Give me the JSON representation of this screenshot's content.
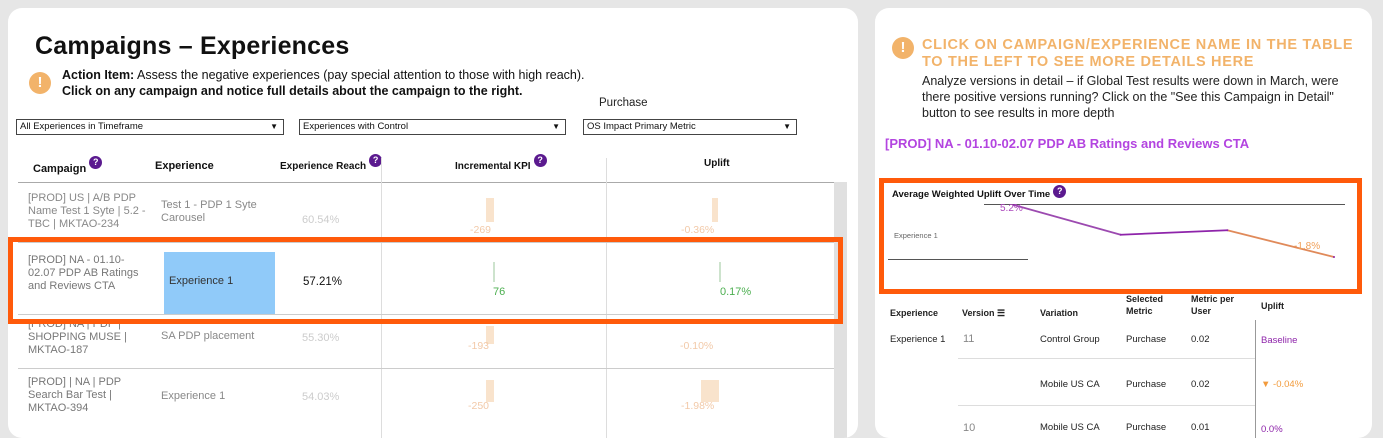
{
  "left": {
    "title": "Campaigns – Experiences",
    "action_label": "Action Item:",
    "action_text": " Assess the negative experiences (pay special attention to those with high reach).",
    "action_bold": "Click on any campaign and notice full details about the campaign to the right.",
    "purchase_label": "Purchase",
    "filters": [
      {
        "value": "All Experiences in Timeframe"
      },
      {
        "value": "Experiences with Control"
      },
      {
        "value": "OS Impact Primary Metric"
      }
    ],
    "headers": {
      "campaign": "Campaign",
      "experience": "Experience",
      "reach": "Experience Reach",
      "kpi": "Incremental KPI",
      "uplift": "Uplift"
    },
    "rows": [
      {
        "campaign": "[PROD] US | A/B PDP Name Test 1 Syte | 5.2 - TBC | MKTAO-234",
        "experience": "Test 1 - PDP 1 Syte Carousel",
        "reach": "60.54%",
        "kpi": "-269",
        "uplift": "-0.36%"
      },
      {
        "campaign": "[PROD] NA - 01.10-02.07 PDP AB Ratings and Reviews CTA",
        "experience": "Experience 1",
        "reach": "57.21%",
        "kpi": "76",
        "uplift": "0.17%"
      },
      {
        "campaign": "[PROD] NA | PDP | SHOPPING MUSE | MKTAO-187",
        "experience": "SA PDP placement",
        "reach": "55.30%",
        "kpi": "-193",
        "uplift": "-0.10%"
      },
      {
        "campaign": "[PROD] | NA | PDP Search Bar Test | MKTAO-394",
        "experience": "Experience 1",
        "reach": "54.03%",
        "kpi": "-250",
        "uplift": "-1.98%"
      }
    ]
  },
  "right": {
    "click_text": "CLICK ON CAMPAIGN/EXPERIENCE NAME IN THE TABLE TO THE LEFT TO SEE MORE DETAILS HERE",
    "analyze_text": "Analyze versions in detail – if Global Test results were down in March, were there positive versions running? Click on the \"See this Campaign in Detail\" button to see results in more depth",
    "campaign_name": "[PROD] NA - 01.10-02.07 PDP AB Ratings and Reviews CTA",
    "chart_title": "Average Weighted Uplift Over Time",
    "table_headers": {
      "experience": "Experience",
      "version": "Version",
      "variation": "Variation",
      "metric": "Selected Metric",
      "metric_per_user": "Metric per User",
      "uplift": "Uplift"
    },
    "table_rows": [
      {
        "experience": "Experience 1",
        "version": "11",
        "variation": "Control Group",
        "metric": "Purchase",
        "per_user": "0.02",
        "uplift": "Baseline"
      },
      {
        "experience": "",
        "version": "",
        "variation": "Mobile US CA",
        "metric": "Purchase",
        "per_user": "0.02",
        "uplift": "▼ -0.04%"
      },
      {
        "experience": "",
        "version": "10",
        "variation": "Mobile US CA",
        "metric": "Purchase",
        "per_user": "0.01",
        "uplift": "0.0%"
      }
    ]
  },
  "chart_data": {
    "type": "line",
    "title": "Average Weighted Uplift Over Time",
    "series": [
      {
        "name": "Experience 1",
        "values": [
          5.2,
          1.2,
          1.8,
          -1.8
        ]
      }
    ],
    "data_labels": [
      "5.2%",
      "-1.8%"
    ]
  },
  "colors": {
    "accent": "#ff5a0a",
    "info": "#f2b36a",
    "purple": "#b344e0",
    "selected": "#90caf9"
  }
}
